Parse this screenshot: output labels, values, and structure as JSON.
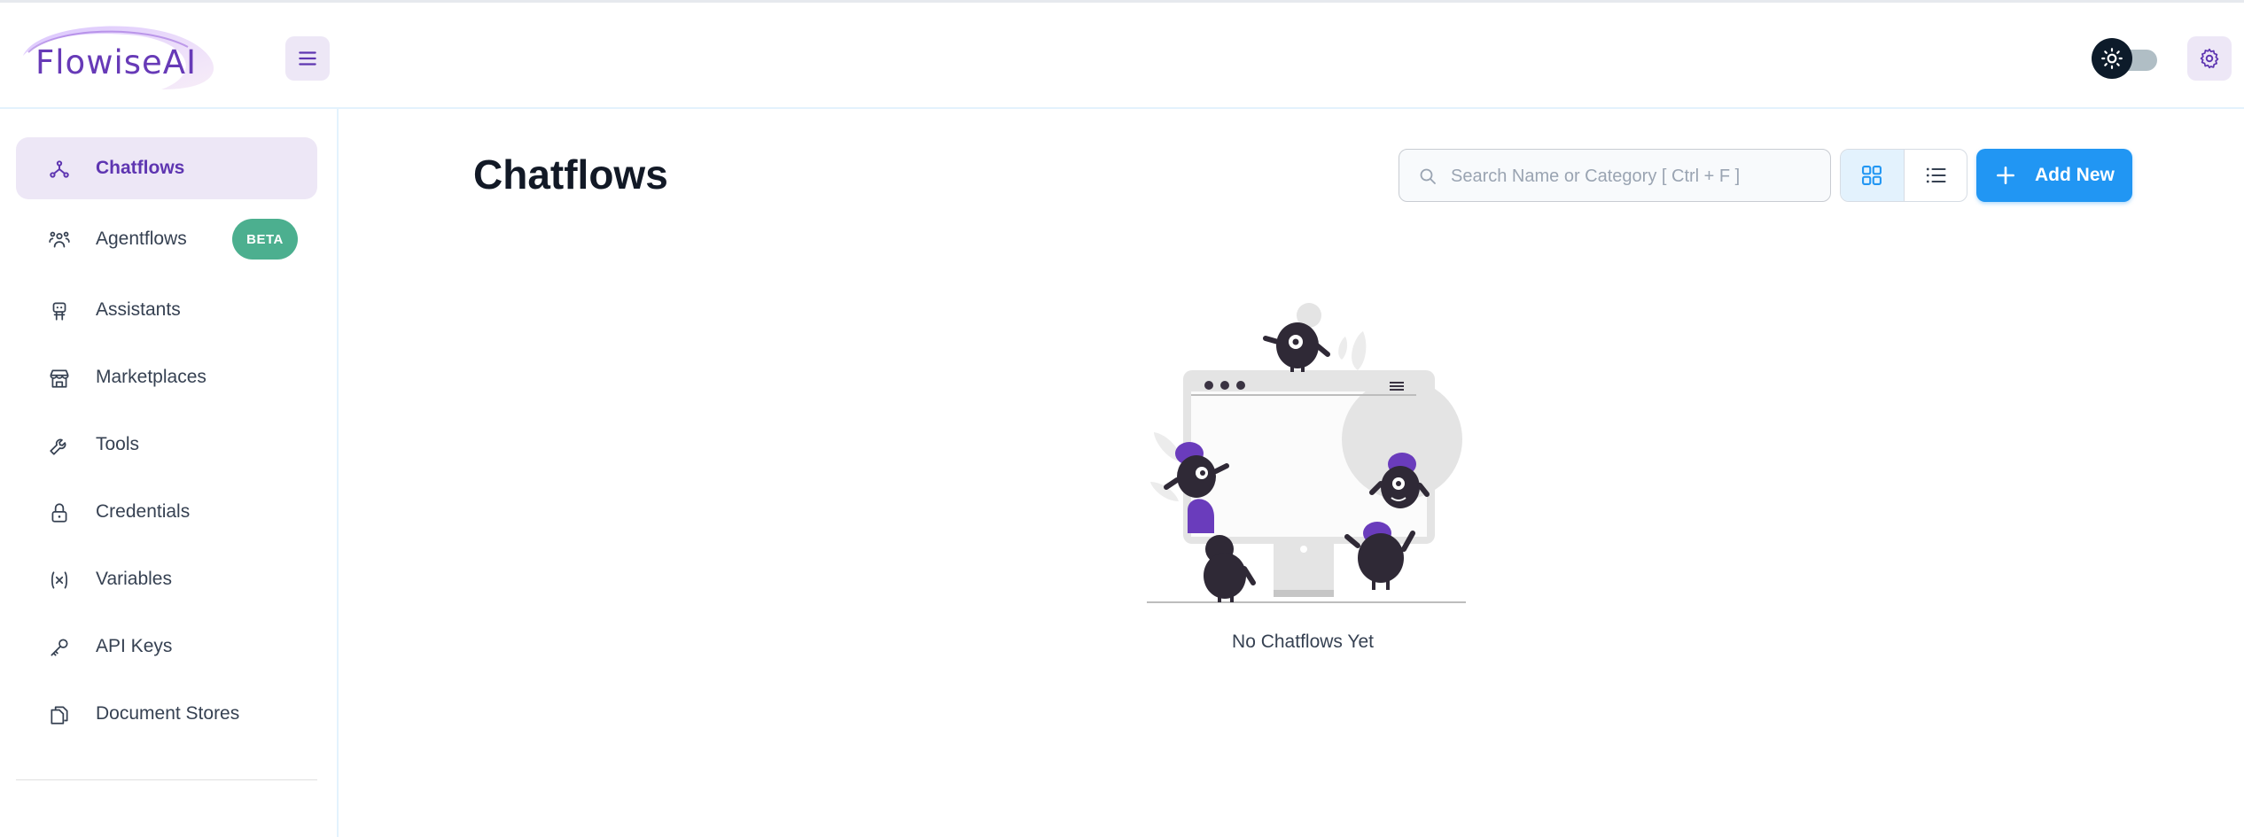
{
  "app": {
    "logo_text": "FlowiseAI"
  },
  "header": {
    "menu_icon": "hamburger-menu-icon",
    "theme_icon": "sun-icon",
    "settings_icon": "gear-icon"
  },
  "sidebar": {
    "items": [
      {
        "label": "Chatflows",
        "icon": "chatflows-icon",
        "active": true
      },
      {
        "label": "Agentflows",
        "icon": "agents-icon",
        "badge": "BETA"
      },
      {
        "label": "Assistants",
        "icon": "robot-icon"
      },
      {
        "label": "Marketplaces",
        "icon": "store-icon"
      },
      {
        "label": "Tools",
        "icon": "wrench-icon"
      },
      {
        "label": "Credentials",
        "icon": "lock-icon"
      },
      {
        "label": "Variables",
        "icon": "variable-icon"
      },
      {
        "label": "API Keys",
        "icon": "key-icon"
      },
      {
        "label": "Document Stores",
        "icon": "files-icon"
      }
    ]
  },
  "main": {
    "title": "Chatflows",
    "search": {
      "placeholder": "Search Name or Category [ Ctrl + F ]",
      "value": ""
    },
    "view_modes": [
      "card-view",
      "list-view"
    ],
    "add_button": "Add New",
    "empty_state": "No Chatflows Yet"
  },
  "colors": {
    "accent": "#673ab7",
    "primary": "#2196f3",
    "beta_badge": "#4caf8f",
    "active_nav_bg": "#ede7f6"
  }
}
